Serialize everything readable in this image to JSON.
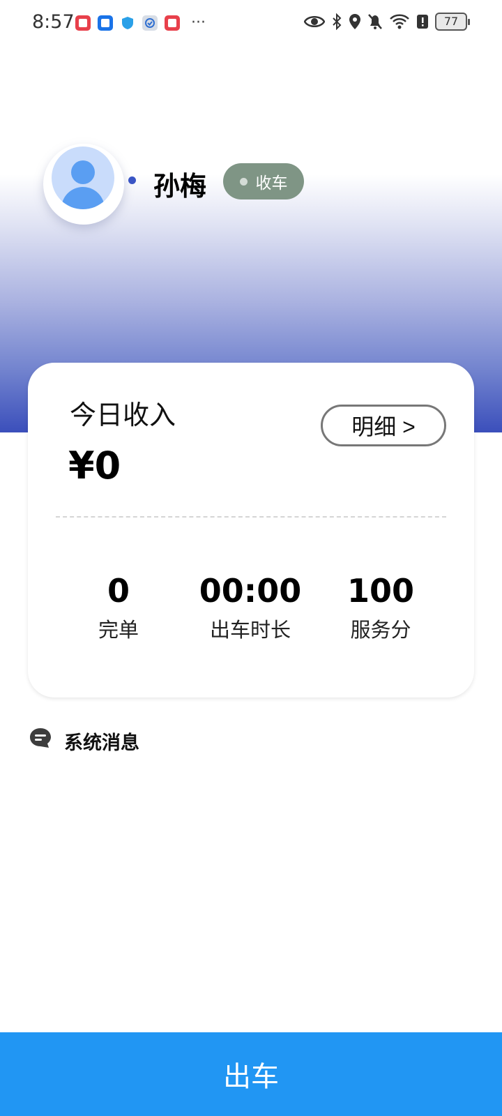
{
  "status_bar": {
    "time": "8:57",
    "more": "···",
    "battery": "77",
    "left_icons": [
      "red-book-app-icon",
      "blue-mail-app-icon",
      "shield-app-icon",
      "security-app-icon",
      "red-book-app-icon"
    ],
    "right_icons": [
      "eye-icon",
      "bluetooth-icon",
      "location-icon",
      "mute-bell-icon",
      "wifi-icon",
      "alert-icon",
      "battery-icon"
    ]
  },
  "profile": {
    "name": "孙梅",
    "status_label": "收车",
    "status_color": "#7f9585",
    "online_color": "#3a55c5"
  },
  "income_card": {
    "title": "今日收入",
    "amount": "¥0",
    "detail_button": "明细 >",
    "stats": [
      {
        "value": "0",
        "label": "完单"
      },
      {
        "value": "00:00",
        "label": "出车时长"
      },
      {
        "value": "100",
        "label": "服务分"
      }
    ]
  },
  "messages": {
    "title": "系统消息"
  },
  "go_button": {
    "label": "出车",
    "color": "#2196f3"
  }
}
